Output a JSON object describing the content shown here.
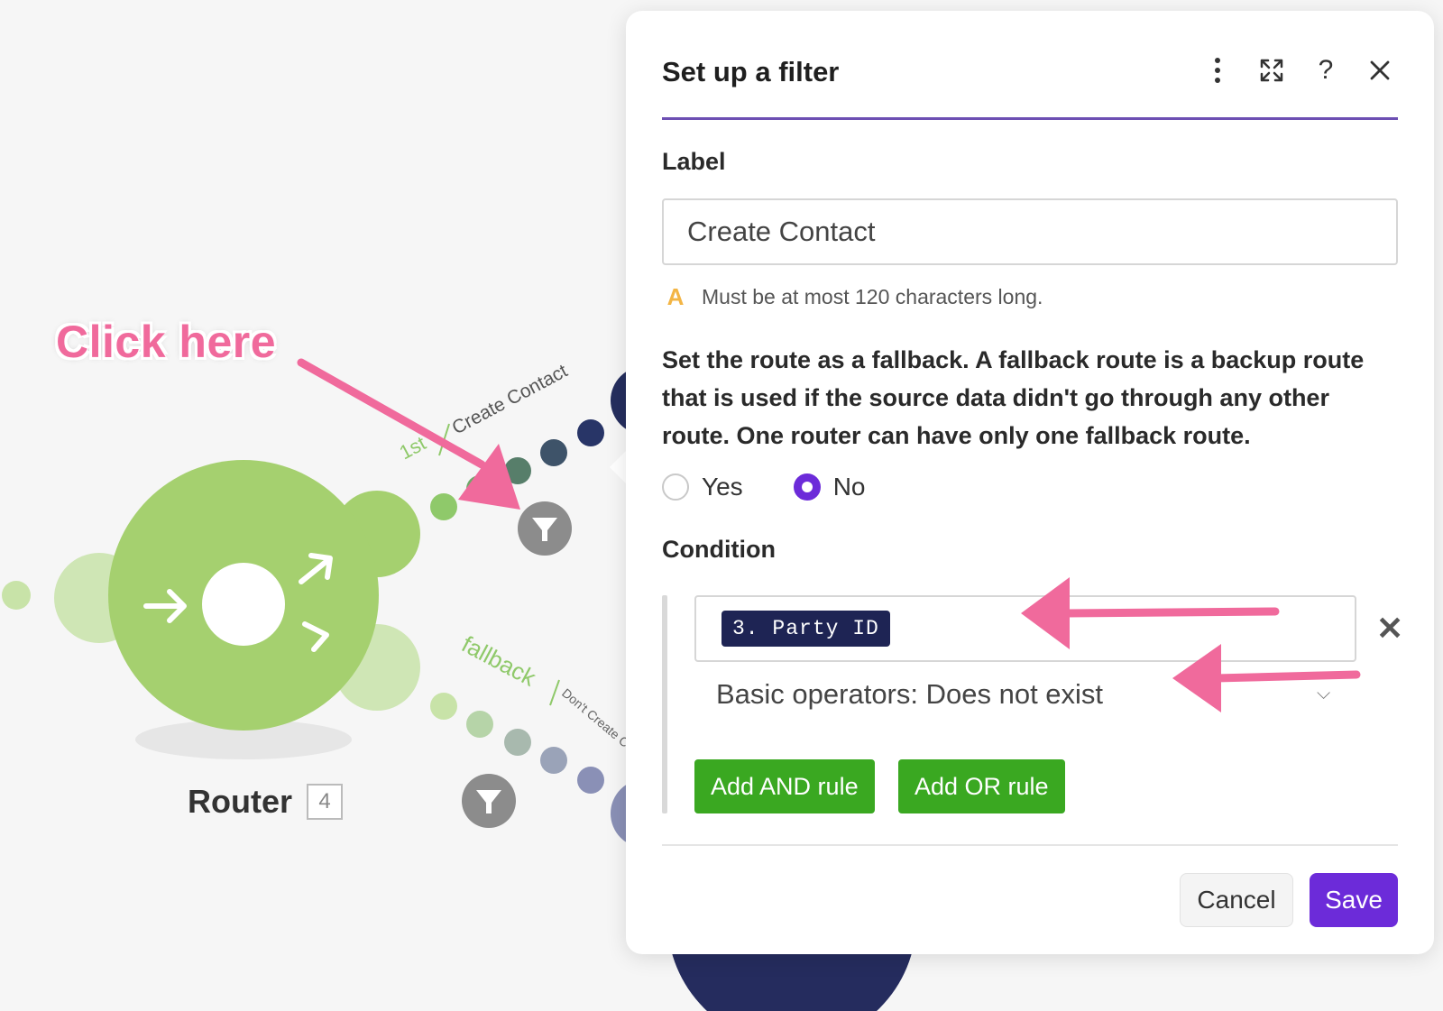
{
  "canvas": {
    "annotation_text": "Click here",
    "router": {
      "label": "Router",
      "badge": "4"
    },
    "route_top": {
      "order": "1st",
      "name": "Create Contact"
    },
    "route_bottom": {
      "order": "fallback",
      "name": "Don't Create Contact(Not No..."
    }
  },
  "panel": {
    "title": "Set up a filter",
    "icons": [
      "more-vertical-icon",
      "fullscreen-icon",
      "help-icon",
      "close-icon"
    ],
    "label_field": {
      "label": "Label",
      "value": "Create Contact",
      "hint": "Must be at most 120 characters long."
    },
    "fallback": {
      "description": "Set the route as a fallback. A fallback route is a backup route that is used if the source data didn't go through any other route. One router can have only one fallback route.",
      "options": [
        "Yes",
        "No"
      ],
      "selected": "No"
    },
    "condition": {
      "label": "Condition",
      "token": "3. Party ID",
      "operator": "Basic operators: Does not exist",
      "add_and_label": "Add AND rule",
      "add_or_label": "Add OR rule"
    },
    "footer": {
      "cancel_label": "Cancel",
      "save_label": "Save"
    }
  },
  "colors": {
    "router_green": "#a5d06f",
    "accent_purple": "#6c2bd9",
    "green_button": "#3aa821",
    "annotation_pink": "#f06a9c",
    "token_navy": "#1e2454"
  }
}
